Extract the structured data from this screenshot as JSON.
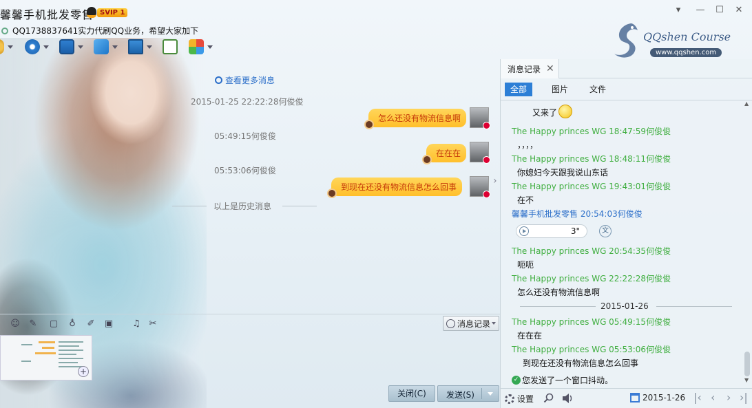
{
  "window": {
    "title": "馨馨手机批发零售",
    "vip_badge": "SVIP 1",
    "signature": "QQ1738837641实力代刷QQ业务，希望大家加下",
    "controls": {
      "minimize": "▾",
      "min": "—",
      "max": "☐",
      "close": "✕"
    }
  },
  "logo": {
    "name": "QQshen Course",
    "url": "www.qqshen.com"
  },
  "toolbar": {
    "icons": [
      "voice-call-icon",
      "video-call-icon",
      "remote-desktop-icon",
      "send-file-icon",
      "screen-share-icon",
      "group-chat-icon",
      "apps-icon"
    ]
  },
  "chat": {
    "view_more": "查看更多消息",
    "messages": [
      {
        "timestamp": "2015-01-25 22:22:28何俊俊",
        "text": "怎么还没有物流信息啊"
      },
      {
        "timestamp": "05:49:15何俊俊",
        "text": "在在在"
      },
      {
        "timestamp": "05:53:06何俊俊",
        "text": "到现在还没有物流信息怎么回事"
      }
    ],
    "history_separator": "以上是历史消息",
    "collapse_arrow": "›"
  },
  "input_toolbar": {
    "history_button": "消息记录",
    "icons": [
      "emoji-icon",
      "magic-font-icon",
      "video-record-icon",
      "voice-message-icon",
      "edit-icon",
      "image-icon",
      "music-icon",
      "screenshot-icon"
    ]
  },
  "buttons": {
    "close": "关闭(C)",
    "send": "发送(S)"
  },
  "history_panel": {
    "tab_label": "消息记录",
    "tab_close": "✕",
    "filters": [
      "全部",
      "图片",
      "文件"
    ],
    "entries": [
      {
        "kind": "text",
        "text": "又来了"
      },
      {
        "kind": "sender",
        "text": "The Happy princes  WG 18:47:59何俊俊"
      },
      {
        "kind": "text",
        "text": "，，，，"
      },
      {
        "kind": "sender",
        "text": "The Happy princes  WG 18:48:11何俊俊"
      },
      {
        "kind": "text",
        "text": "你媳妇今天跟我说山东话"
      },
      {
        "kind": "sender",
        "text": "The Happy princes  WG 19:43:01何俊俊"
      },
      {
        "kind": "text",
        "text": "在不"
      },
      {
        "kind": "me",
        "text": "馨馨手机批发零售 20:54:03何俊俊"
      },
      {
        "kind": "sender",
        "text": "The Happy princes  WG 20:54:35何俊俊"
      },
      {
        "kind": "text",
        "text": "呃呃"
      },
      {
        "kind": "sender",
        "text": "The Happy princes  WG 22:22:28何俊俊"
      },
      {
        "kind": "text",
        "text": "怎么还没有物流信息啊"
      },
      {
        "kind": "sender",
        "text": "The Happy princes  WG 05:49:15何俊俊"
      },
      {
        "kind": "text",
        "text": "在在在"
      },
      {
        "kind": "sender",
        "text": "The Happy princes  WG 05:53:06何俊俊"
      },
      {
        "kind": "text",
        "text": "到现在还没有物流信息怎么回事"
      }
    ],
    "voice_duration": "3\"",
    "voice_convert": "文",
    "date_separator": "2015-01-26",
    "shake_notice": "您发送了一个窗口抖动。",
    "bottom": {
      "settings": "设置",
      "date": "2015-1-26",
      "nav": [
        "|‹",
        "‹",
        "›",
        "›|"
      ]
    }
  },
  "colors": {
    "accent": "#2d7fd6",
    "bubble": "#ffc93a",
    "sender_green": "#3fae3f",
    "sender_blue": "#2c6fc9"
  }
}
